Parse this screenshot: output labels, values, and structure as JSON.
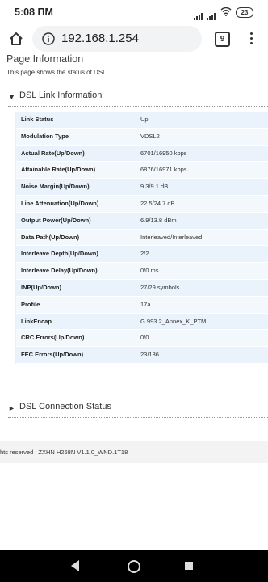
{
  "status_bar": {
    "time": "5:08 ПМ",
    "battery": "23"
  },
  "browser": {
    "url": "192.168.1.254",
    "tab_count": "9"
  },
  "page": {
    "title": "Page Information",
    "description": "This page shows the status of DSL.",
    "link_section": "DSL Link Information",
    "connection_section": "DSL Connection Status",
    "rows": [
      {
        "key": "Link Status",
        "value": "Up"
      },
      {
        "key": "Modulation Type",
        "value": "VDSL2"
      },
      {
        "key": "Actual Rate(Up/Down)",
        "value": "6701/16950 kbps"
      },
      {
        "key": "Attainable Rate(Up/Down)",
        "value": "6876/16971 kbps"
      },
      {
        "key": "Noise Margin(Up/Down)",
        "value": "9.3/9.1 dB"
      },
      {
        "key": "Line Attenuation(Up/Down)",
        "value": "22.5/24.7 dB"
      },
      {
        "key": "Output Power(Up/Down)",
        "value": "6.9/13.8 dBm"
      },
      {
        "key": "Data Path(Up/Down)",
        "value": "Interleaved/Interleaved"
      },
      {
        "key": "Interleave Depth(Up/Down)",
        "value": "2/2"
      },
      {
        "key": "Interleave Delay(Up/Down)",
        "value": "0/0 ms"
      },
      {
        "key": "INP(Up/Down)",
        "value": "27/29 symbols"
      },
      {
        "key": "Profile",
        "value": "17a"
      },
      {
        "key": "LinkEncap",
        "value": "G.993.2_Annex_K_PTM"
      },
      {
        "key": "CRC Errors(Up/Down)",
        "value": "0/0"
      },
      {
        "key": "FEC Errors(Up/Down)",
        "value": "23/186"
      }
    ],
    "footer": "hts reserved  |   ZXHN H268N V1.1.0_WND.1T18"
  }
}
